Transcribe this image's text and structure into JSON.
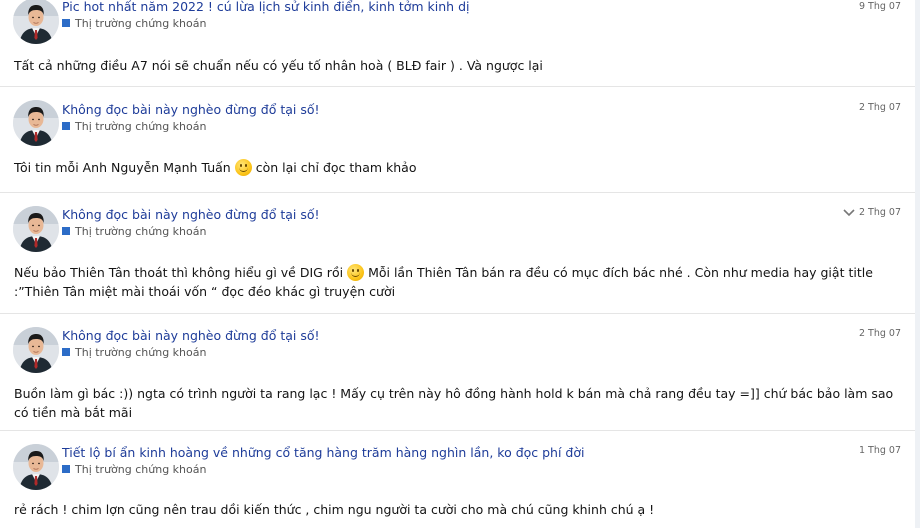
{
  "posts": [
    {
      "title": "Pic hot nhất năm 2022 ! cú lừa lịch sử kinh điển, kinh tởm kinh dị",
      "category": "Thị trường chứng khoán",
      "date": "9 Thg 07",
      "body_parts": [
        "Tất cả những điều A7 nói sẽ chuẩn nếu có yếu tố nhân hoà ( BLĐ fair ) . Và ngược lại"
      ]
    },
    {
      "title": "Không đọc bài này nghèo đừng đổ tại số!",
      "category": "Thị trường chứng khoán",
      "date": "2 Thg 07",
      "body_parts": [
        "Tôi tin mỗi Anh Nguyễn Mạnh Tuấn",
        "còn lại chỉ đọc tham khảo"
      ],
      "emoji": "smile-emoji"
    },
    {
      "title": "Không đọc bài này nghèo đừng đổ tại số!",
      "category": "Thị trường chứng khoán",
      "date": "2 Thg 07",
      "chevron": "chevron-down-icon",
      "body_parts": [
        "Nếu bảo Thiên Tân thoát thì không hiểu gì về DIG rồi",
        "Mỗi lần Thiên Tân bán ra đều có mục đích bác nhé . Còn như media hay giật title :”Thiên Tân miệt mài thoái vốn “ đọc đéo khác gì truyện cười"
      ],
      "emoji": "smile-emoji"
    },
    {
      "title": "Không đọc bài này nghèo đừng đổ tại số!",
      "category": "Thị trường chứng khoán",
      "date": "2 Thg 07",
      "body_parts": [
        "Buồn làm gì bác :)) ngta có trình người ta rang lạc ! Mấy cụ trên này hô đồng hành hold k bán mà chả rang đều tay =]] chứ bác bảo làm sao có tiền mà bắt mãi"
      ]
    },
    {
      "title": "Tiết lộ bí ẩn kinh hoàng về những cổ tăng hàng trăm hàng nghìn lần, ko đọc phí đời",
      "category": "Thị trường chứng khoán",
      "date": "1 Thg 07",
      "body_parts": [
        "rẻ rách ! chim lợn cũng nên trau dồi kiến thức , chim ngu người ta cười cho mà chú cũng khinh chú ạ !"
      ]
    }
  ],
  "colors": {
    "title": "#1e3c99",
    "category_marker": "#2c6cc7",
    "divider": "#e5e5e5"
  }
}
